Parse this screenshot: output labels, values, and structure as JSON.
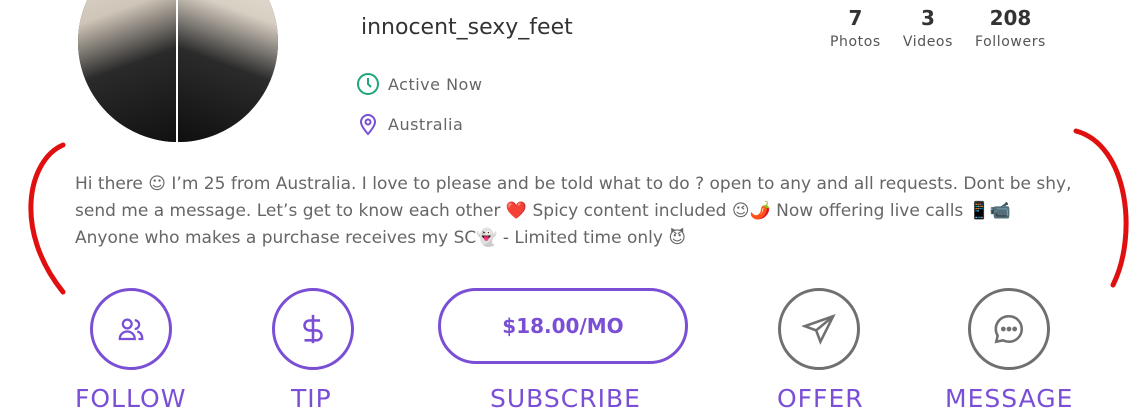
{
  "profile": {
    "username": "innocent_sexy_feet",
    "status": "Active Now",
    "location": "Australia"
  },
  "stats": [
    {
      "value": "7",
      "label": "Photos"
    },
    {
      "value": "3",
      "label": "Videos"
    },
    {
      "value": "208",
      "label": "Followers"
    }
  ],
  "bio": {
    "text": "Hi there ☺ I’m 25 from Australia. I love to please and be told what to do ? open to any and all requests. Dont be shy, send me a message. Let’s get to know each other ❤️ Spicy content included 😉🌶️ Now offering live calls 📱📹 Anyone who makes a purchase receives my SC👻 - Limited time only 😈"
  },
  "actions": {
    "follow_label": "FOLLOW",
    "tip_label": "TIP",
    "subscribe_price": "$18.00/MO",
    "subscribe_label": "SUBSCRIBE",
    "offer_label": "OFFER",
    "message_label": "MESSAGE"
  },
  "colors": {
    "accent": "#7a4fd6",
    "active_green": "#1fa67a",
    "location_purple": "#7a4fd6",
    "annotation_red": "#e01010"
  }
}
